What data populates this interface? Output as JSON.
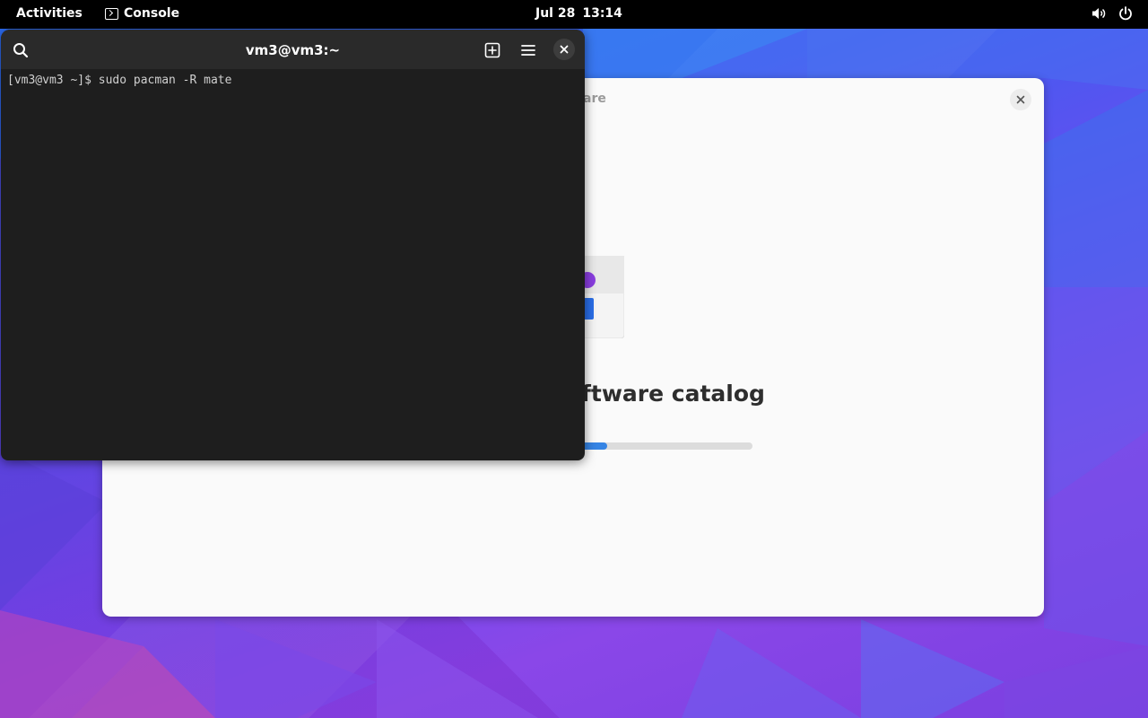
{
  "topbar": {
    "activities_label": "Activities",
    "app_name": "Console",
    "date": "Jul 28",
    "time": "13:14",
    "icons": [
      "volume-icon",
      "power-icon"
    ]
  },
  "software_window": {
    "title_fragment": "are",
    "heading_fragment": "ftware catalog",
    "progress_fraction": 0.46,
    "accent_color": "#3584e4"
  },
  "terminal": {
    "title": "vm3@vm3:~",
    "prompt": "[vm3@vm3 ~]$ ",
    "command": "sudo pacman -R mate",
    "background": "#1e1e1e",
    "header_buttons": [
      "search-icon",
      "new-tab-icon",
      "menu-icon",
      "close-icon"
    ]
  }
}
